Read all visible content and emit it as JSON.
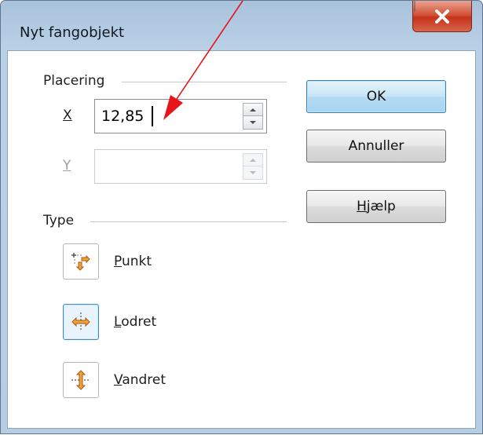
{
  "window": {
    "title": "Nyt fangobjekt"
  },
  "placement": {
    "group_title": "Placering",
    "x_label": "X",
    "x_value": "12,85",
    "y_label": "Y",
    "y_value": ""
  },
  "type": {
    "group_title": "Type",
    "options": [
      {
        "label": "Punkt",
        "mnemonic": "P",
        "rest": "unkt",
        "icon": "point-icon",
        "selected": false
      },
      {
        "label": "Lodret",
        "mnemonic": "L",
        "rest": "odret",
        "icon": "vertical-line-icon",
        "selected": true
      },
      {
        "label": "Vandret",
        "mnemonic": "V",
        "rest": "andret",
        "icon": "horizontal-line-icon",
        "selected": false
      }
    ]
  },
  "buttons": {
    "ok": "OK",
    "cancel": "Annuller",
    "help_mnemonic": "H",
    "help_rest": "jælp"
  },
  "colors": {
    "accent_arrow": "#e8141b",
    "default_button": "#b5dbf3",
    "close_button": "#c5331a"
  }
}
